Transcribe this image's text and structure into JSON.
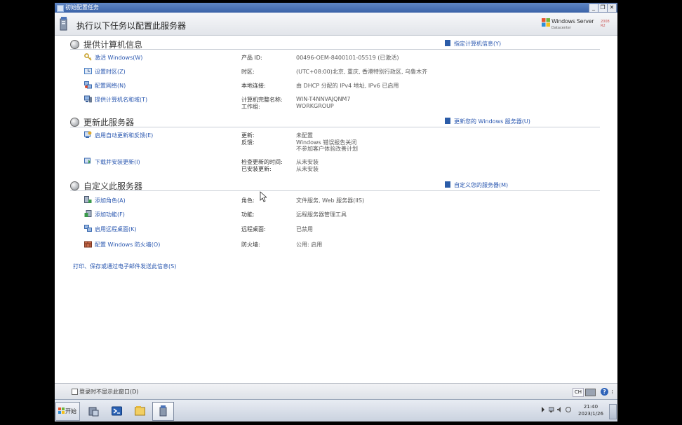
{
  "window": {
    "title": "初始配置任务",
    "header_title": "执行以下任务以配置此服务器",
    "buttons": {
      "minimize": "_",
      "restore": "❐",
      "close": "✕"
    }
  },
  "brand": {
    "name": "Windows Server",
    "version": "2008 R2",
    "edition": "Datacenter"
  },
  "sections": [
    {
      "title": "提供计算机信息",
      "link": "指定计算机信息(Y)",
      "tasks": [
        {
          "label": "激活 Windows(W)",
          "icon": "key-icon",
          "color": "#c8a22e"
        },
        {
          "label": "设置时区(Z)",
          "icon": "clock-icon",
          "color": "#4a7fc4"
        },
        {
          "label": "配置网络(N)",
          "icon": "network-icon",
          "color": "#3a6ab0"
        },
        {
          "label": "提供计算机名和域(T)",
          "icon": "computer-icon",
          "color": "#3a5f9a"
        }
      ],
      "props": [
        {
          "label": "产品 ID:",
          "value": "00496-OEM-8400101-05519 (已激活)"
        },
        {
          "label": "时区:",
          "value": "(UTC+08:00)北京, 重庆, 香港特别行政区, 乌鲁木齐"
        },
        {
          "label": "本地连接:",
          "value": "由 DHCP 分配的 IPv4 地址, IPv6 已启用"
        },
        {
          "label": "计算机完整名称:",
          "value": "WIN-T4NNVAJQNM7"
        },
        {
          "label": "工作组:",
          "value": "WORKGROUP"
        }
      ]
    },
    {
      "title": "更新此服务器",
      "link": "更新您的 Windows 服务器(U)",
      "tasks": [
        {
          "label": "启用自动更新和反馈(E)",
          "icon": "update-icon",
          "color": "#3a6ab0"
        },
        {
          "label": "下载并安装更新(I)",
          "icon": "download-icon",
          "color": "#3a9a4a"
        }
      ],
      "props": [
        {
          "label": "更新:",
          "value": "未配置"
        },
        {
          "label": "反馈:",
          "value": "Windows 错误报告关闭"
        },
        {
          "label": "",
          "value": "不参加客户体验改善计划"
        },
        {
          "label": "检查更新的时间:",
          "value": "从未安装"
        },
        {
          "label": "已安装更新:",
          "value": "从未安装"
        }
      ]
    },
    {
      "title": "自定义此服务器",
      "link": "自定义您的服务器(M)",
      "tasks": [
        {
          "label": "添加角色(A)",
          "icon": "roles-icon",
          "color": "#3a9a4a"
        },
        {
          "label": "添加功能(F)",
          "icon": "features-icon",
          "color": "#3a9a4a"
        },
        {
          "label": "启用远程桌面(K)",
          "icon": "remote-desktop-icon",
          "color": "#3a6ab0"
        },
        {
          "label": "配置 Windows 防火墙(O)",
          "icon": "firewall-icon",
          "color": "#b0543a"
        }
      ],
      "props": [
        {
          "label": "角色:",
          "value": "文件服务, Web 服务器(IIS)"
        },
        {
          "label": "功能:",
          "value": "远程服务器管理工具"
        },
        {
          "label": "远程桌面:",
          "value": "已禁用"
        },
        {
          "label": "防火墙:",
          "value": "公用: 启用"
        }
      ]
    }
  ],
  "print_link": "打印、保存或通过电子邮件发送此信息(S)",
  "footer": {
    "checkbox_label": "登录时不显示此窗口(D)",
    "lang": "CH"
  },
  "taskbar": {
    "start_label": "开始",
    "apps": [
      {
        "name": "server-manager-icon"
      },
      {
        "name": "powershell-icon"
      },
      {
        "name": "explorer-icon"
      },
      {
        "name": "initial-config-icon"
      }
    ],
    "clock_time": "21:40",
    "clock_date": "2023/1/26"
  }
}
